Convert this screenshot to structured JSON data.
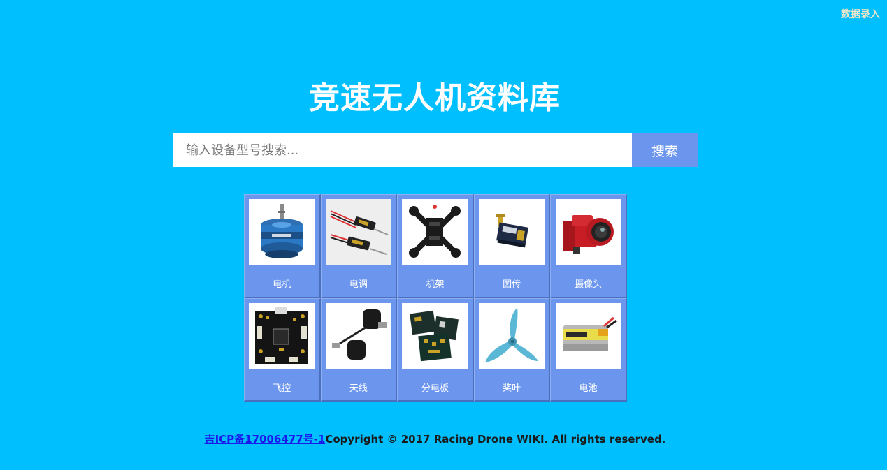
{
  "header": {
    "data_entry_link": "数据录入",
    "title": "竞速无人机资料库"
  },
  "search": {
    "placeholder": "输入设备型号搜索...",
    "button_label": "搜索"
  },
  "categories": [
    {
      "label": "电机",
      "icon": "motor-image"
    },
    {
      "label": "电调",
      "icon": "esc-image"
    },
    {
      "label": "机架",
      "icon": "frame-image"
    },
    {
      "label": "图传",
      "icon": "vtx-image"
    },
    {
      "label": "摄像头",
      "icon": "camera-image"
    },
    {
      "label": "飞控",
      "icon": "flight-controller-image"
    },
    {
      "label": "天线",
      "icon": "antenna-image"
    },
    {
      "label": "分电板",
      "icon": "pdb-image"
    },
    {
      "label": "桨叶",
      "icon": "propeller-image"
    },
    {
      "label": "电池",
      "icon": "battery-image"
    }
  ],
  "footer": {
    "icp_link": "吉ICP备17006477号-1",
    "copyright": "Copyright © 2017 Racing Drone WIKI. All rights reserved."
  },
  "colors": {
    "background": "#00bfff",
    "tile": "#6c96ee",
    "button": "#6c96ee"
  }
}
